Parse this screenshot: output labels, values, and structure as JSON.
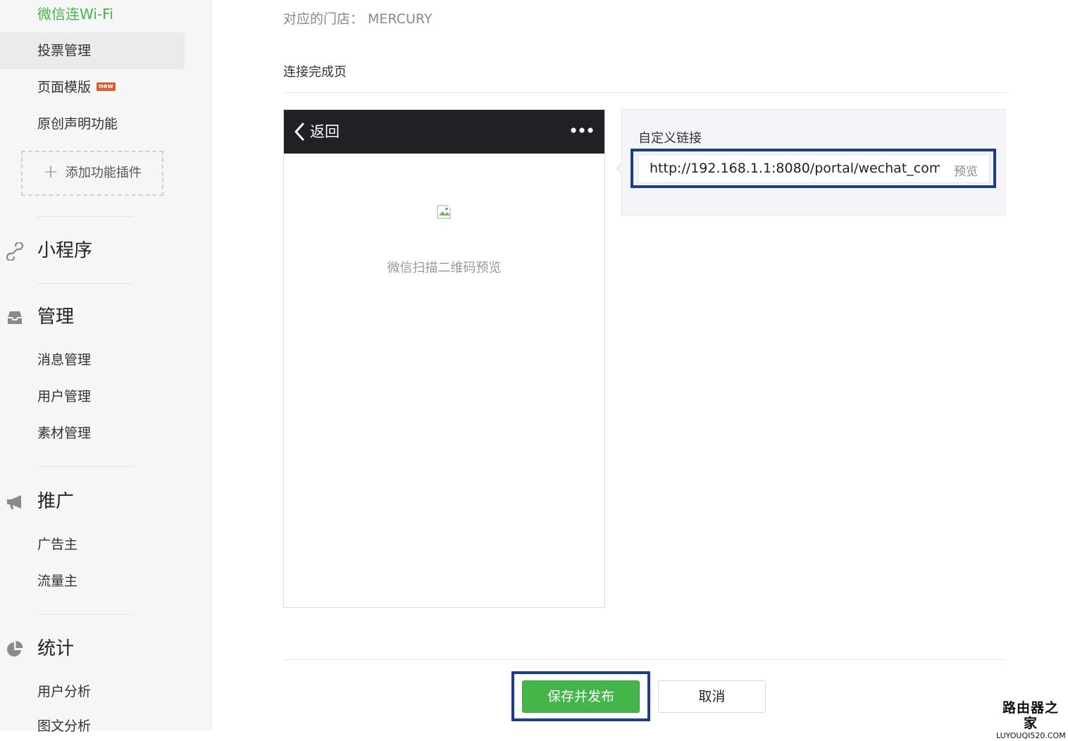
{
  "sidebar": {
    "top_items": [
      {
        "label": "微信连Wi-Fi"
      },
      {
        "label": "投票管理"
      },
      {
        "label": "页面模版",
        "badge": "new"
      },
      {
        "label": "原创声明功能"
      }
    ],
    "add_plugin_label": "添加功能插件",
    "sections": [
      {
        "title": "小程序",
        "icon": "link-icon",
        "items": []
      },
      {
        "title": "管理",
        "icon": "inbox-icon",
        "items": [
          "消息管理",
          "用户管理",
          "素材管理"
        ]
      },
      {
        "title": "推广",
        "icon": "megaphone-icon",
        "items": [
          "广告主",
          "流量主"
        ]
      },
      {
        "title": "统计",
        "icon": "pie-chart-icon",
        "items": [
          "用户分析",
          "图文分析"
        ]
      }
    ]
  },
  "main": {
    "store_label": "对应的门店： MERCURY",
    "page_label": "连接完成页",
    "phone": {
      "back_label": "返回",
      "qr_caption": "微信扫描二维码预览"
    },
    "custom_link": {
      "title": "自定义链接",
      "value": "http://192.168.1.1:8080/portal/wechat_com",
      "preview_label": "预览"
    },
    "buttons": {
      "save_label": "保存并发布",
      "cancel_label": "取消"
    }
  },
  "watermark": {
    "cn": "路由器之家",
    "en": "LUYOUQI520.COM"
  },
  "colors": {
    "accent_green": "#44b549",
    "highlight_blue": "#1d3c8f",
    "new_badge": "#e45a26",
    "phone_bar": "#1f2124"
  }
}
